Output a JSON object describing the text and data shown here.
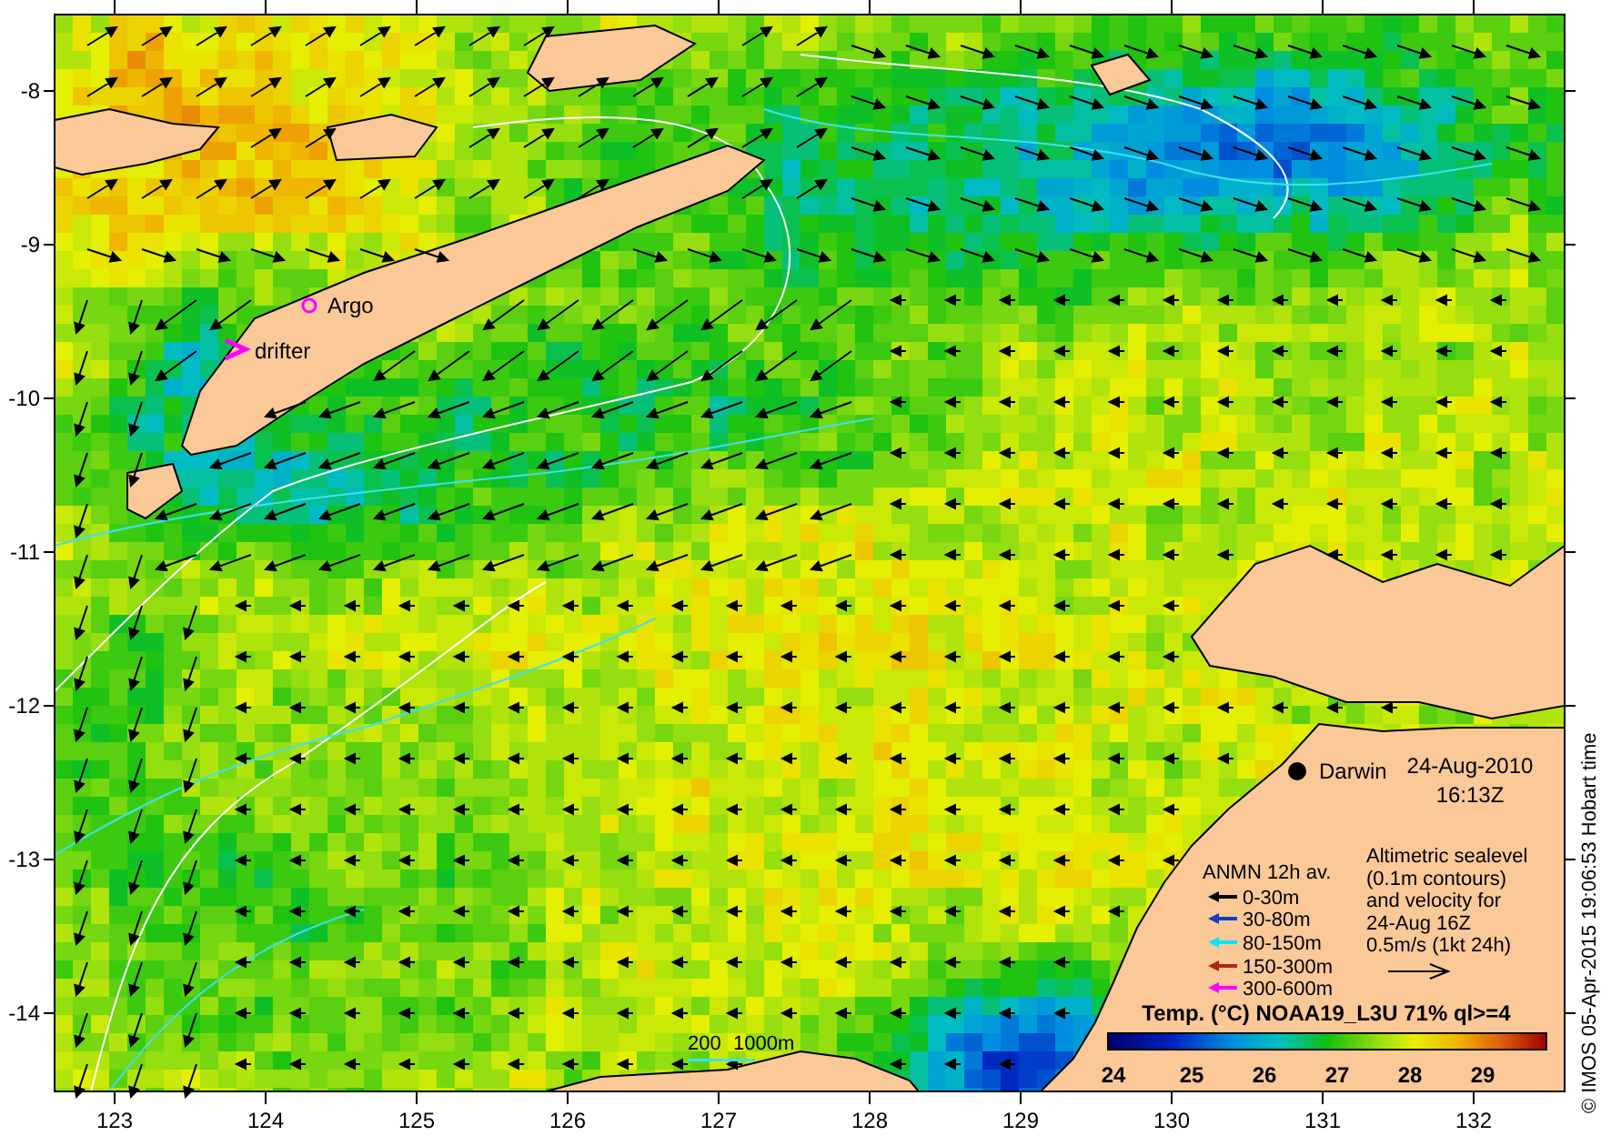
{
  "map": {
    "y_axis_labels": [
      "-8",
      "-9",
      "-10",
      "-11",
      "-12",
      "-13",
      "-14"
    ],
    "x_axis_labels": [
      "123",
      "124",
      "125",
      "126",
      "127",
      "128",
      "129",
      "130",
      "131",
      "132"
    ],
    "place_labels": [
      {
        "text": "Argo",
        "kind": "argo"
      },
      {
        "text": "drifter",
        "kind": "drifter"
      },
      {
        "text": "Darwin",
        "kind": "city"
      }
    ],
    "date": "24-Aug-2010",
    "time": "16:13Z",
    "scale_labels": [
      "200",
      "1000m"
    ]
  },
  "legend": {
    "title": "ANMN 12h av.",
    "items": [
      {
        "label": "0-30m",
        "color": "#000000"
      },
      {
        "label": "30-80m",
        "color": "#1040c0"
      },
      {
        "label": "80-150m",
        "color": "#00e8ff"
      },
      {
        "label": "150-300m",
        "color": "#b02808"
      },
      {
        "label": "300-600m",
        "color": "#ff00ff"
      }
    ]
  },
  "altimetry_note": {
    "lines": [
      "Altimetric sealevel",
      "(0.1m contours)",
      "and velocity for",
      "24-Aug 16Z",
      "0.5m/s (1kt 24h)"
    ]
  },
  "colorbar": {
    "title": "Temp. (°C) NOAA19_L3U 71% ql>=4",
    "labels": [
      "24",
      "25",
      "26",
      "27",
      "28",
      "29"
    ]
  },
  "credit": "© IMOS 05-Apr-2015 19:06:53 Hobart time"
}
